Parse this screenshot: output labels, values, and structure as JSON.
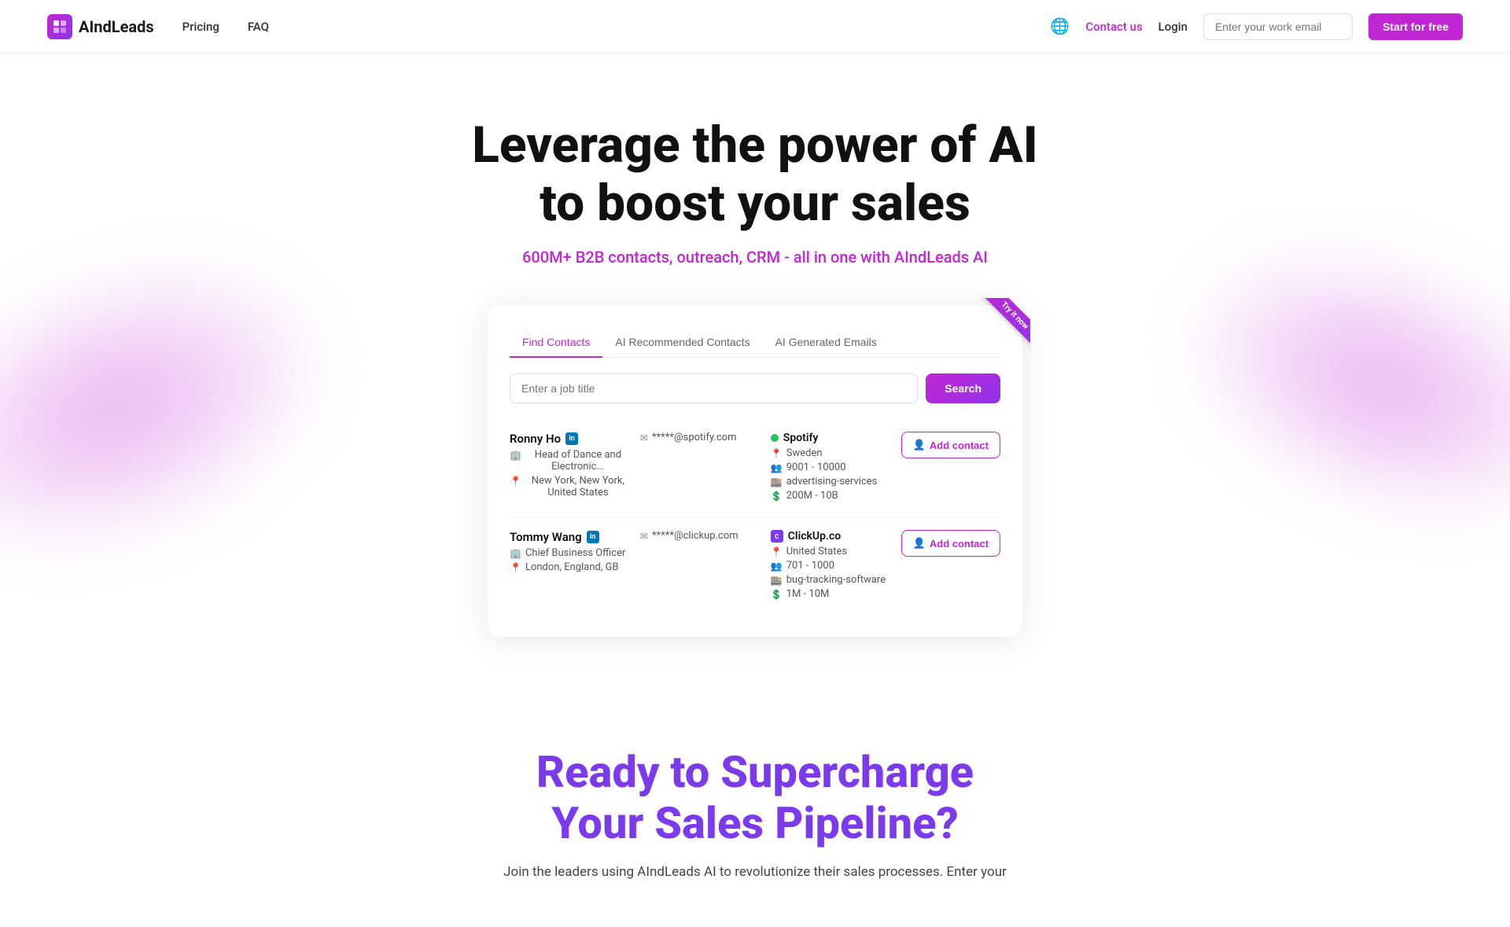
{
  "nav": {
    "logo_text": "AIndLeads",
    "logo_icon": "A",
    "pricing_label": "Pricing",
    "faq_label": "FAQ",
    "contact_label": "Contact us",
    "login_label": "Login",
    "email_placeholder": "Enter your work email",
    "start_btn_label": "Start for free"
  },
  "hero": {
    "title_line1": "Leverage the power of AI",
    "title_line2": "to boost your sales",
    "subtitle": "600M+ B2B contacts, outreach, CRM - all in one with AIndLeads AI"
  },
  "card": {
    "ribbon_label": "Try it now",
    "tabs": [
      {
        "id": "find",
        "label": "Find Contacts",
        "active": true
      },
      {
        "id": "ai-recommended",
        "label": "AI Recommended Contacts",
        "active": false
      },
      {
        "id": "ai-emails",
        "label": "AI Generated Emails",
        "active": false
      }
    ],
    "search_placeholder": "Enter a job title",
    "search_btn": "Search",
    "contacts": [
      {
        "name": "Ronny Ho",
        "email": "*****@spotify.com",
        "title": "Head of Dance and Electronic...",
        "location": "New York, New York, United States",
        "company": "Spotify",
        "company_active": true,
        "company_country": "Sweden",
        "company_employees": "9001 - 10000",
        "company_revenue": "200M - 10B",
        "company_category": "advertising-services",
        "add_btn": "Add contact"
      },
      {
        "name": "Tommy Wang",
        "email": "*****@clickup.com",
        "title": "Chief Business Officer",
        "location": "London, England, GB",
        "company": "ClickUp.co",
        "company_active": false,
        "company_country": "United States",
        "company_employees": "701 - 1000",
        "company_revenue": "1M - 10M",
        "company_category": "bug-tracking-software",
        "add_btn": "Add contact"
      }
    ]
  },
  "cta": {
    "title_line1": "Ready to Supercharge",
    "title_line2": "Your Sales Pipeline?",
    "subtitle": "Join the leaders using AIndLeads AI to revolutionize their sales processes. Enter your"
  },
  "icons": {
    "globe": "🌐",
    "email": "✉",
    "briefcase": "💼",
    "pin": "📍",
    "building": "🏢",
    "users": "👥",
    "dollar": "💲",
    "add": "👤+"
  }
}
